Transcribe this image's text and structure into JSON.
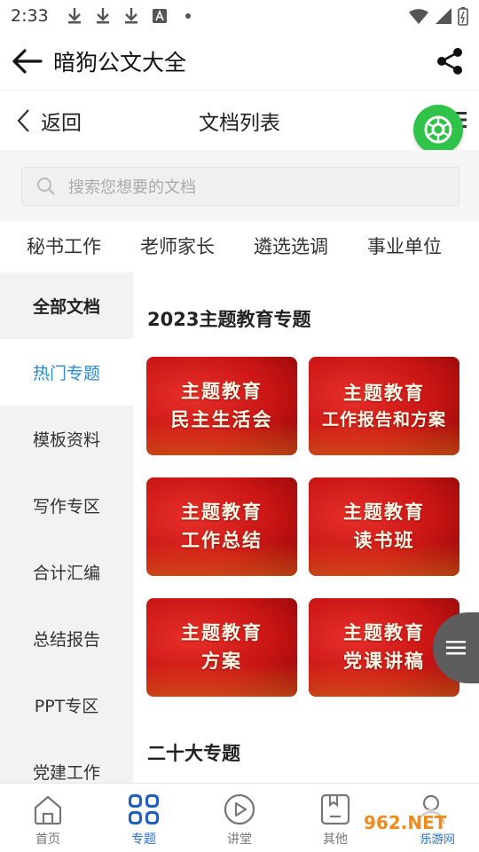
{
  "status_bar": {
    "time": "2:33"
  },
  "app_bar": {
    "title": "暗狗公文大全"
  },
  "web_header": {
    "back_label": "返回",
    "title": "文档列表"
  },
  "search": {
    "placeholder": "搜索您想要的文档"
  },
  "category_tabs": [
    "秘书工作",
    "老师家长",
    "遴选选调",
    "事业单位"
  ],
  "sidebar": {
    "items": [
      "全部文档",
      "热门专题",
      "模板资料",
      "写作专区",
      "合计汇编",
      "总结报告",
      "PPT专区",
      "党建工作"
    ],
    "active_index": 1
  },
  "main": {
    "section1_title": "2023主题教育专题",
    "cards": [
      {
        "line1": "主题教育",
        "line2": "民主生活会"
      },
      {
        "line1": "主题教育",
        "line2": "工作报告和方案"
      },
      {
        "line1": "主题教育",
        "line2": "工作总结"
      },
      {
        "line1": "主题教育",
        "line2": "读书班"
      },
      {
        "line1": "主题教育",
        "line2": "方案"
      },
      {
        "line1": "主题教育",
        "line2": "党课讲稿"
      }
    ],
    "section2_title": "二十大专题"
  },
  "bottom_nav": {
    "items": [
      {
        "label": "首页",
        "icon": "home-icon"
      },
      {
        "label": "专题",
        "icon": "grid-icon"
      },
      {
        "label": "讲堂",
        "icon": "play-icon"
      },
      {
        "label": "其他",
        "icon": "bookmark-icon"
      },
      {
        "label": "我的",
        "icon": "user-icon"
      }
    ],
    "active_index": 1
  },
  "watermark": {
    "text": "962.NET",
    "subtext": "乐游网"
  },
  "colors": {
    "accent_blue": "#2a8bd8",
    "nav_active": "#2a6fd1",
    "card_red": "#c81414",
    "green_button": "#2fc34a"
  }
}
